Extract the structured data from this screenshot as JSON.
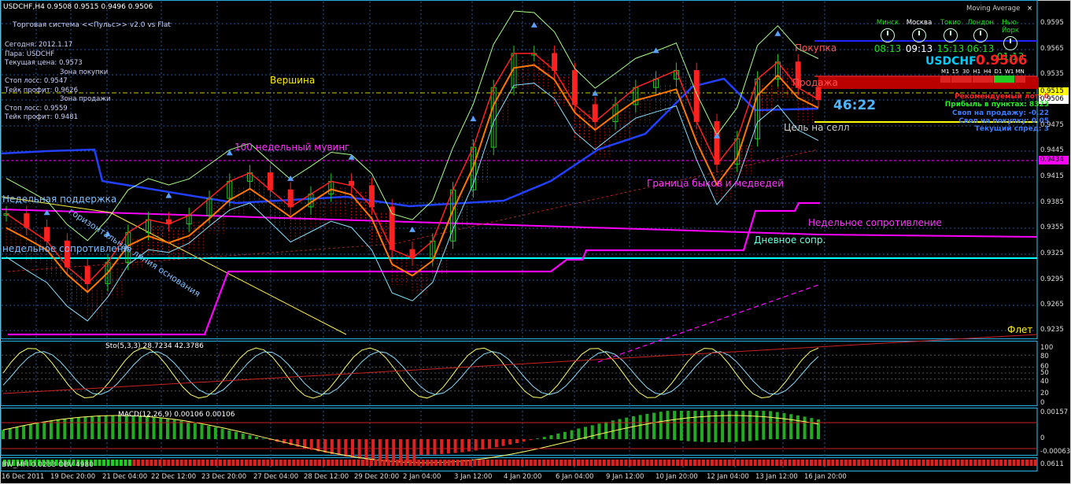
{
  "header": {
    "symbol_line": "USDCHF,H4  0.9508 0.9515 0.9496 0.9506",
    "system_name": "Торговая система <<Пульс>> v2.0 vs Flat",
    "indicator_tab": "Moving Average",
    "close_icon": "close-icon"
  },
  "info_panel": {
    "today": "Сегодня:  2012.1.17",
    "pair": "Пара:  USDCHF",
    "price": "Текущая цена: 0.9573",
    "buy_zone": "Зона покупки",
    "stop1": "Стоп лосс:   0.9547",
    "take1": "Тейк профит:  0.9626",
    "sell_zone": "Зона продажи",
    "stop2": "Стоп лосс:   0.9559",
    "take2": "Тейк профит:  0.9481"
  },
  "clocks": [
    {
      "city": "Минск",
      "time": "08:13",
      "color": "#22dd22"
    },
    {
      "city": "Москва",
      "time": "09:13",
      "color": "#ffffff"
    },
    {
      "city": "Токио",
      "time": "15:13",
      "color": "#22dd22"
    },
    {
      "city": "Лондон",
      "time": "06:13",
      "color": "#22dd22"
    },
    {
      "city": "Нью-Йорк",
      "time": "01:13",
      "color": "#22dd22"
    }
  ],
  "quote_panel": {
    "pair": "USDCHF",
    "price": "0.9506",
    "timeframes": [
      "M1",
      "15",
      "30",
      "H1",
      "H4",
      "D1",
      "W1",
      "MN"
    ],
    "timer": "46:22",
    "recommended_lot": "Рекомендуемый лот: 0",
    "profit_points": "Прибыль в пунктах: 8323",
    "swap_sell": "Своп на продажу: -0.22",
    "swap_buy": "Своп на покупку: 0.05",
    "spread": "Текущий спред: 3"
  },
  "annotations": {
    "vershina": "Вершина",
    "moving100": "100 недельный мувинг",
    "weekly_support": "Недельная поддержка",
    "weekly_resistance_left": "недельное сопротивлени",
    "trend_line": "горизонтальная линия основания",
    "bull_bear": "Граница быков и медведей",
    "weekly_resistance": "Недельное сопротивление",
    "daily_resistance": "Дневное сопр.",
    "buy": "Покупка",
    "sell": "Продажа",
    "target_sell": "Цель на селл",
    "flat": "Флет"
  },
  "price_axis": [
    "0.9595",
    "0.9565",
    "0.9535",
    "0.9505",
    "0.9475",
    "0.9445",
    "0.9415",
    "0.9385",
    "0.9355",
    "0.9325",
    "0.9295",
    "0.9265",
    "0.9235"
  ],
  "price_tags": [
    {
      "value": "0.9515",
      "color": "#ffff00"
    },
    {
      "value": "0.9506",
      "color": "#ffffff"
    },
    {
      "value": "0.9434",
      "color": "#ff00ff"
    }
  ],
  "stoch": {
    "label": "Sto(5,3,3) 28.7234 42.3786",
    "levels": [
      "100",
      "80",
      "60",
      "50",
      "40",
      "20",
      "0"
    ]
  },
  "macd": {
    "label": "MACD(12,26,9) 0.00106 0.00106",
    "levels": [
      "0.00157",
      "0",
      "-0.00063"
    ]
  },
  "bottom": {
    "label": "BW_MFI 0.0233 OBV 4980",
    "level": "0.0611"
  },
  "time_axis": [
    "16 Dec 2011",
    "19 Dec 20:00",
    "21 Dec 04:00",
    "22 Dec 12:00",
    "23 Dec 20:00",
    "27 Dec 04:00",
    "28 Dec 12:00",
    "29 Dec 20:00",
    "2 Jan 04:00",
    "3 Jan 12:00",
    "4 Jan 20:00",
    "6 Jan 04:00",
    "9 Jan 12:00",
    "10 Jan 20:00",
    "12 Jan 04:00",
    "13 Jan 12:00",
    "16 Jan 20:00"
  ],
  "colors": {
    "grid": "#1f5a9e",
    "separator": "#25a5d8",
    "bull": "#22cc22",
    "bear": "#ff2020",
    "magenta": "#ff00ff",
    "cyan": "#00ffff",
    "yellow": "#ffff00",
    "blue": "#2222ff",
    "orange": "#ff7700"
  },
  "chart_data": {
    "type": "line",
    "title": "USDCHF,H4",
    "series": [
      {
        "name": "USDCHF",
        "values": [
          0.9372,
          0.9356,
          0.934,
          0.931,
          0.929,
          0.9315,
          0.935,
          0.9365,
          0.936,
          0.937,
          0.939,
          0.941,
          0.942,
          0.94,
          0.938,
          0.9395,
          0.941,
          0.9405,
          0.938,
          0.933,
          0.932,
          0.934,
          0.94,
          0.945,
          0.952,
          0.956,
          0.956,
          0.954,
          0.95,
          0.948,
          0.95,
          0.952,
          0.953,
          0.954,
          0.948,
          0.943,
          0.946,
          0.953,
          0.955,
          0.952,
          0.9506
        ]
      }
    ],
    "ylim": [
      0.9225,
      0.96
    ]
  }
}
